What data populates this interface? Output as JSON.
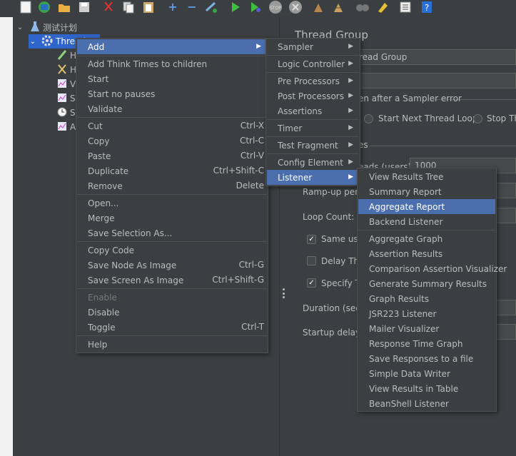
{
  "tree": {
    "root_label": "测试计划",
    "thread_group_label": "Thread G",
    "children_prefixes": [
      "H",
      "H",
      "V",
      "S",
      "S",
      "A"
    ]
  },
  "right": {
    "title": "Thread Group",
    "name_value": "read Group",
    "sampler_error_label": "en after a Sampler error",
    "start_next_label": "Start Next Thread Loop",
    "stop_label": "Stop Th",
    "props_label": "es",
    "threads_label": "eads (users):",
    "threads_value": "1000",
    "rampup_label": "Ramp-up peri",
    "loop_label": "Loop Count:",
    "same_user_label": "Same use",
    "delay_label": "Delay Thr",
    "specify_label": "Specify T",
    "duration_label": "Duration (seco",
    "startup_label": "Startup delay ("
  },
  "context_menu": {
    "add": "Add",
    "think_times": "Add Think Times to children",
    "start": "Start",
    "start_no_pauses": "Start no pauses",
    "validate": "Validate",
    "cut": "Cut",
    "cut_sc": "Ctrl-X",
    "copy": "Copy",
    "copy_sc": "Ctrl-C",
    "paste": "Paste",
    "paste_sc": "Ctrl-V",
    "duplicate": "Duplicate",
    "duplicate_sc": "Ctrl+Shift-C",
    "remove": "Remove",
    "remove_sc": "Delete",
    "open": "Open...",
    "merge": "Merge",
    "save_selection": "Save Selection As...",
    "copy_code": "Copy Code",
    "save_node_image": "Save Node As Image",
    "save_node_image_sc": "Ctrl-G",
    "save_screen_image": "Save Screen As Image",
    "save_screen_image_sc": "Ctrl+Shift-G",
    "enable": "Enable",
    "disable": "Disable",
    "toggle": "Toggle",
    "toggle_sc": "Ctrl-T",
    "help": "Help"
  },
  "add_menu": {
    "sampler": "Sampler",
    "logic_controller": "Logic Controller",
    "pre_processors": "Pre Processors",
    "post_processors": "Post Processors",
    "assertions": "Assertions",
    "timer": "Timer",
    "test_fragment": "Test Fragment",
    "config_element": "Config Element",
    "listener": "Listener"
  },
  "listener_menu": {
    "items_top": [
      "View Results Tree",
      "Summary Report",
      "Aggregate Report",
      "Backend Listener"
    ],
    "items_bottom": [
      "Aggregate Graph",
      "Assertion Results",
      "Comparison Assertion Visualizer",
      "Generate Summary Results",
      "Graph Results",
      "JSR223 Listener",
      "Mailer Visualizer",
      "Response Time Graph",
      "Save Responses to a file",
      "Simple Data Writer",
      "View Results in Table",
      "BeanShell Listener"
    ]
  },
  "colors": {
    "background": "#3c3f41",
    "highlight": "#4b6eaf",
    "tree_selection": "#2f65ca",
    "text": "#bbbbbb"
  }
}
